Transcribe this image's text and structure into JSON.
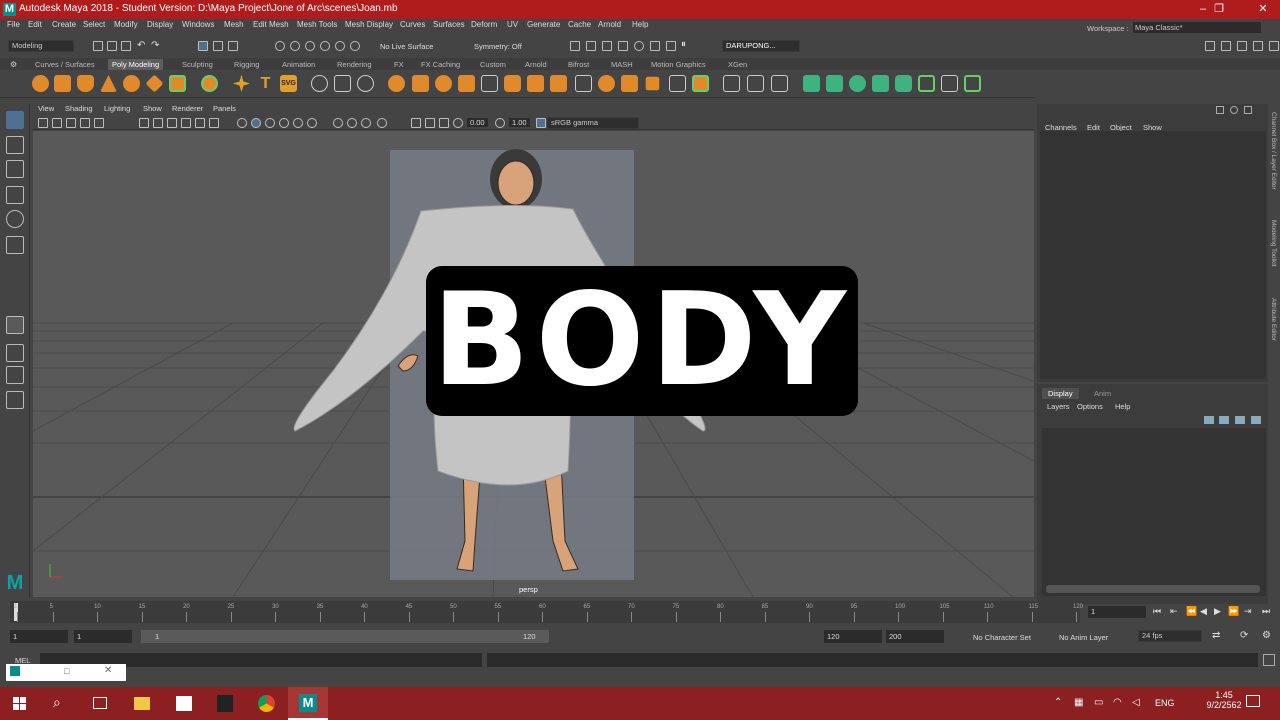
{
  "window": {
    "title": "Autodesk Maya 2018 - Student Version: D:\\Maya Project\\Jone of Arc\\scenes\\Joan.mb",
    "logo": "M",
    "controls": [
      "–",
      "❐",
      "✕"
    ]
  },
  "menubar": {
    "items": [
      "File",
      "Edit",
      "Create",
      "Select",
      "Modify",
      "Display",
      "Windows",
      "Mesh",
      "Edit Mesh",
      "Mesh Tools",
      "Mesh Display",
      "Curves",
      "Surfaces",
      "Deform",
      "UV",
      "Generate",
      "Cache",
      "Arnold",
      "Help"
    ],
    "workspace_label": "Workspace :",
    "workspace_value": "Maya Classic*"
  },
  "statusline": {
    "menuset": "Modeling",
    "live_surface": "No Live Surface",
    "symmetry": "Symmetry: Off",
    "user": "DARUPONG..."
  },
  "shelf": {
    "tabs": [
      "Curves / Surfaces",
      "Poly Modeling",
      "Sculpting",
      "Rigging",
      "Animation",
      "Rendering",
      "FX",
      "FX Caching",
      "Custom",
      "Arnold",
      "Bifrost",
      "MASH",
      "Motion Graphics",
      "XGen"
    ],
    "active_tab": "Poly Modeling",
    "svg_label": "SVG",
    "text_label": "T"
  },
  "viewport": {
    "menu": [
      "View",
      "Shading",
      "Lighting",
      "Show",
      "Renderer",
      "Panels"
    ],
    "exposure": "0.00",
    "gamma": "1.00",
    "colorspace": "sRGB gamma",
    "camera_label": "persp",
    "overlay_text": "BODY",
    "ground": "#5a5a5a"
  },
  "channelbox": {
    "menu": [
      "Channels",
      "Edit",
      "Object",
      "Show"
    ]
  },
  "layereditor": {
    "tabs": [
      "Display",
      "Anim"
    ],
    "menu": [
      "Layers",
      "Options",
      "Help"
    ]
  },
  "sidetabs": [
    "Channel Box / Layer Editor",
    "Modeling Toolkit",
    "Attribute Editor"
  ],
  "timeslider": {
    "ticks": [
      "1",
      "5",
      "10",
      "15",
      "20",
      "25",
      "30",
      "35",
      "40",
      "45",
      "50",
      "55",
      "60",
      "65",
      "70",
      "75",
      "80",
      "85",
      "90",
      "95",
      "100",
      "105",
      "110",
      "115",
      "120"
    ],
    "current_frame": "1"
  },
  "range": {
    "start": "1",
    "playback_start": "1",
    "range_start": "1",
    "range_end": "120",
    "playback_end": "120",
    "end": "200",
    "character_set": "No Character Set",
    "anim_layer": "No Anim Layer",
    "fps": "24 fps"
  },
  "cmdline": {
    "label": "MEL"
  },
  "taskbar": {
    "language": "ENG",
    "time": "1:45",
    "date": "9/2/2562"
  },
  "colors": {
    "titlebar": "#b01c1c",
    "taskbar": "#8c1f1f",
    "maya_teal": "#0b8b8b",
    "active_tool": "#4e6f92"
  }
}
